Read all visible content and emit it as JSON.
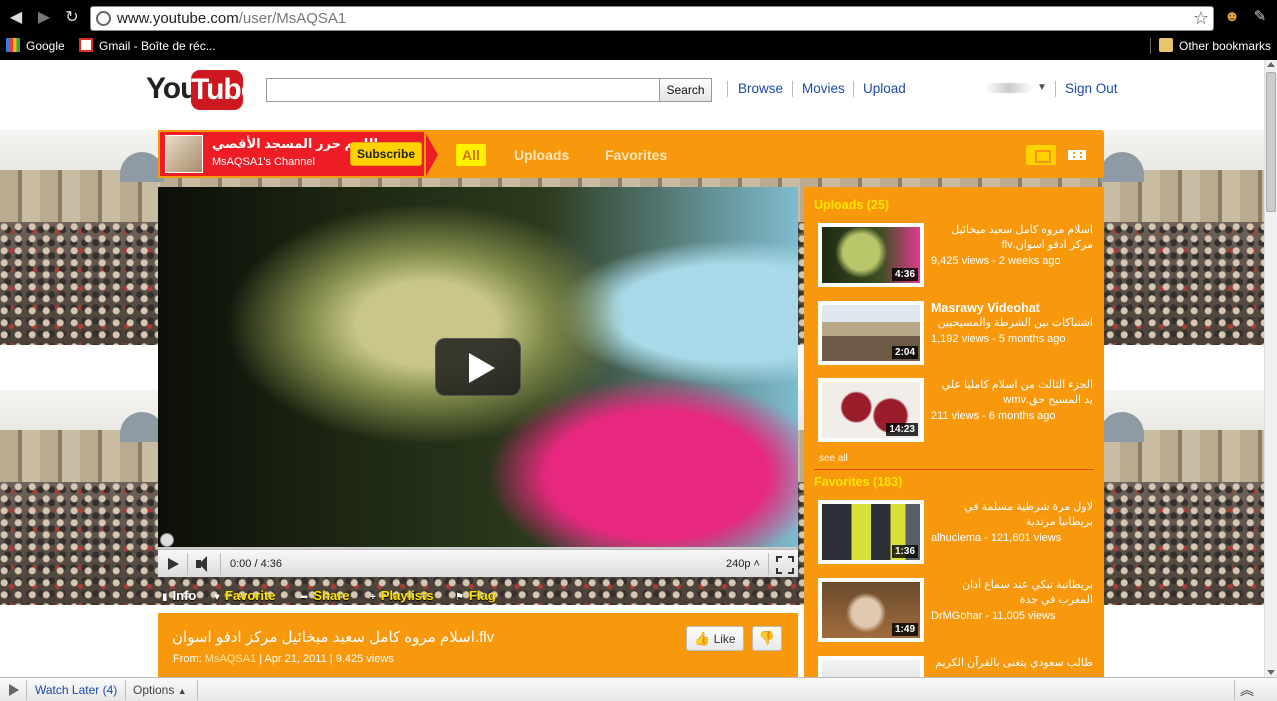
{
  "browser": {
    "url_host": "www.youtube.com",
    "url_path": "/user/MsAQSA1",
    "bookmarks": [
      {
        "label": "Google",
        "icon": "google-icon"
      },
      {
        "label": "Gmail - Boîte de réc...",
        "icon": "gmail-icon"
      }
    ],
    "other_bookmarks": "Other bookmarks"
  },
  "header": {
    "logo_you": "You",
    "logo_tube": "Tube",
    "search_button": "Search",
    "links": [
      "Browse",
      "Movies",
      "Upload"
    ],
    "sign_out": "Sign Out"
  },
  "channel": {
    "title": "اللهم حرر المسجد الأقصي",
    "subtitle": "MsAQSA1's Channel",
    "subscribe": "Subscribe",
    "tabs": [
      "All",
      "Uploads",
      "Favorites"
    ],
    "active_tab": "All"
  },
  "player": {
    "time": "0:00 / 4:36",
    "quality": "240p",
    "progress": 0
  },
  "actions": {
    "info": "Info",
    "favorite": "Favorite",
    "share": "Share",
    "playlists": "Playlists",
    "flag": "Flag"
  },
  "video": {
    "title": "اسلام مروه كامل سعيد ميخائيل مركز ادفو اسوان.flv",
    "from_label": "From:",
    "author": "MsAQSA1",
    "date": "Apr 21, 2011",
    "views": "9,425 views",
    "like": "Like"
  },
  "sidebar": {
    "uploads_heading": "Uploads (25)",
    "uploads": [
      {
        "title": "اسلام مروه كامل سعيد ميخائيل مركز ادفو اسوان.flv",
        "meta": "9,425 views - 2 weeks ago",
        "duration": "4:36"
      },
      {
        "title": "Masrawy Videohat",
        "subtitle": "اشتباكات بين الشرطة والمسيحيين",
        "meta": "1,192 views - 5 months ago",
        "duration": "2:04"
      },
      {
        "title": "الجزء الثالث من اسلام كامليا علي يد المسيح حق.wmv",
        "meta": "211 views - 6 months ago",
        "duration": "14:23"
      }
    ],
    "see_all": "see all",
    "favorites_heading": "Favorites (183)",
    "favorites": [
      {
        "title": "لاول مرة شرطية مسلمة في بريطانيا مرتدية",
        "meta": "alhuciema - 121,601 views",
        "duration": "1:36"
      },
      {
        "title": "بريطانية تبكي عند سماع أذان المغرب في جدة",
        "meta": "DrMGohar - 11,005 views",
        "duration": "1:49"
      },
      {
        "title": "طالب سعودي يتغنى بالقرآن الكريم",
        "meta": "",
        "duration": ""
      }
    ]
  },
  "bottom": {
    "watch_later": "Watch Later (4)",
    "options": "Options"
  }
}
